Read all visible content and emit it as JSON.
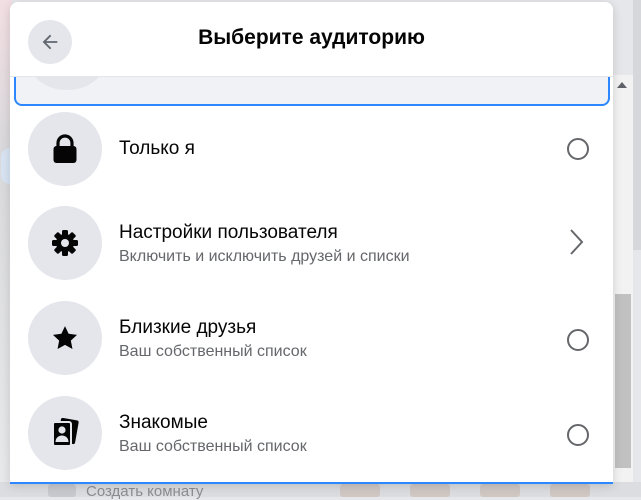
{
  "header": {
    "title": "Выберите аудиторию"
  },
  "options": [
    {
      "title": "Только я",
      "subtitle": "",
      "icon": "lock-icon",
      "control": "radio"
    },
    {
      "title": "Настройки пользователя",
      "subtitle": "Включить и исключить друзей и списки",
      "icon": "gear-icon",
      "control": "chevron"
    },
    {
      "title": "Близкие друзья",
      "subtitle": "Ваш собственный список",
      "icon": "star-icon",
      "control": "radio"
    },
    {
      "title": "Знакомые",
      "subtitle": "Ваш собственный список",
      "icon": "acquaintances-icon",
      "control": "radio"
    }
  ],
  "background": {
    "bottom_text": "Создать комнату"
  },
  "colors": {
    "accent": "#2d88ff",
    "icon_bg": "#e4e6eb",
    "secondary_text": "#65676b"
  }
}
